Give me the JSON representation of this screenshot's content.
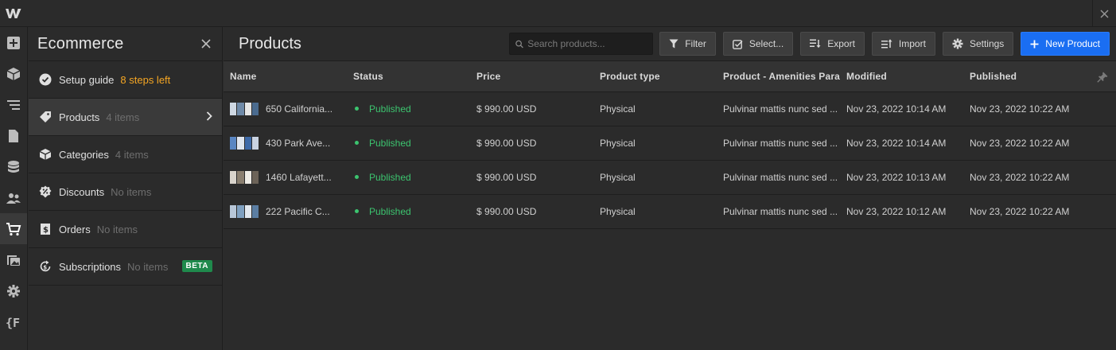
{
  "app": {
    "logo_letter": "W"
  },
  "panel": {
    "title": "Ecommerce",
    "items": [
      {
        "label": "Setup guide",
        "count": "8 steps left",
        "icon": "check-circle-icon"
      },
      {
        "label": "Products",
        "count": "4 items",
        "icon": "tag-icon"
      },
      {
        "label": "Categories",
        "count": "4 items",
        "icon": "box-icon"
      },
      {
        "label": "Discounts",
        "count": "No items",
        "icon": "discount-badge-icon"
      },
      {
        "label": "Orders",
        "count": "No items",
        "icon": "receipt-icon"
      },
      {
        "label": "Subscriptions",
        "count": "No items",
        "icon": "refresh-dollar-icon",
        "badge": "BETA"
      }
    ]
  },
  "main": {
    "title": "Products",
    "search_placeholder": "Search products...",
    "buttons": {
      "filter": "Filter",
      "select": "Select...",
      "export": "Export",
      "import": "Import",
      "settings": "Settings",
      "new_product": "New Product"
    },
    "columns": [
      "Name",
      "Status",
      "Price",
      "Product type",
      "Product - Amenities Paragraph",
      "Modified",
      "Published"
    ],
    "rows": [
      {
        "name": "650 California...",
        "status": "Published",
        "price": "$ 990.00 USD",
        "type": "Physical",
        "amenities": "Pulvinar mattis nunc sed ...",
        "modified": "Nov 23, 2022 10:14 AM",
        "published": "Nov 23, 2022 10:22 AM",
        "thumb_colors": [
          "#cfd8e3",
          "#6f8aa8",
          "#e6e6e6",
          "#4a6b8f"
        ]
      },
      {
        "name": "430 Park Ave...",
        "status": "Published",
        "price": "$ 990.00 USD",
        "type": "Physical",
        "amenities": "Pulvinar mattis nunc sed ...",
        "modified": "Nov 23, 2022 10:14 AM",
        "published": "Nov 23, 2022 10:22 AM",
        "thumb_colors": [
          "#5a86c2",
          "#e0e6ef",
          "#3e6aa8",
          "#c9d3e2"
        ]
      },
      {
        "name": "1460 Lafayett...",
        "status": "Published",
        "price": "$ 990.00 USD",
        "type": "Physical",
        "amenities": "Pulvinar mattis nunc sed ...",
        "modified": "Nov 23, 2022 10:13 AM",
        "published": "Nov 23, 2022 10:22 AM",
        "thumb_colors": [
          "#d9d4cc",
          "#8a7f70",
          "#efece6",
          "#6c6358"
        ]
      },
      {
        "name": "222 Pacific C...",
        "status": "Published",
        "price": "$ 990.00 USD",
        "type": "Physical",
        "amenities": "Pulvinar mattis nunc sed ...",
        "modified": "Nov 23, 2022 10:12 AM",
        "published": "Nov 23, 2022 10:22 AM",
        "thumb_colors": [
          "#b8c7d8",
          "#7fa0c0",
          "#e2e8ef",
          "#5b7ea3"
        ]
      }
    ]
  },
  "colors": {
    "accent": "#1a6ef2",
    "published": "#3cc46f",
    "warning": "#f5a623",
    "beta": "#1f8a4c"
  }
}
